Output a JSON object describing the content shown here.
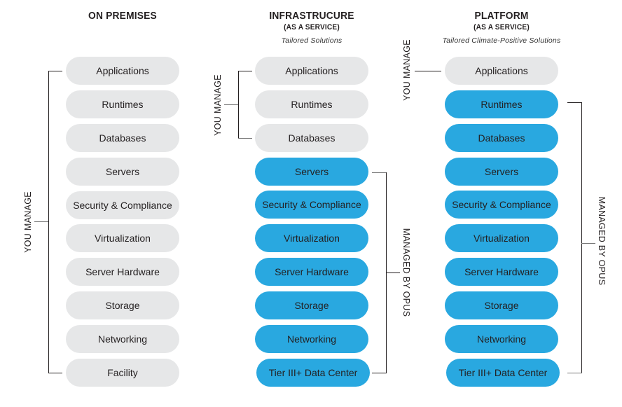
{
  "colors": {
    "customer_managed": "#E6E7E8",
    "opus_managed": "#29A8E0",
    "text": "#231F20"
  },
  "columns": [
    {
      "title": "ON PREMISES",
      "subtitle": "",
      "tagline": "",
      "items": [
        {
          "label": "Applications",
          "managed_by": "you"
        },
        {
          "label": "Runtimes",
          "managed_by": "you"
        },
        {
          "label": "Databases",
          "managed_by": "you"
        },
        {
          "label": "Servers",
          "managed_by": "you"
        },
        {
          "label": "Security & Compliance",
          "managed_by": "you"
        },
        {
          "label": "Virtualization",
          "managed_by": "you"
        },
        {
          "label": "Server Hardware",
          "managed_by": "you"
        },
        {
          "label": "Storage",
          "managed_by": "you"
        },
        {
          "label": "Networking",
          "managed_by": "you"
        },
        {
          "label": "Facility",
          "managed_by": "you"
        }
      ],
      "brackets": {
        "you_manage": "YOU MANAGE"
      }
    },
    {
      "title": "INFRASTRUCURE",
      "subtitle": "(AS A SERVICE)",
      "tagline": "Tailored Solutions",
      "items": [
        {
          "label": "Applications",
          "managed_by": "you"
        },
        {
          "label": "Runtimes",
          "managed_by": "you"
        },
        {
          "label": "Databases",
          "managed_by": "you"
        },
        {
          "label": "Servers",
          "managed_by": "opus"
        },
        {
          "label": "Security & Compliance",
          "managed_by": "opus"
        },
        {
          "label": "Virtualization",
          "managed_by": "opus"
        },
        {
          "label": "Server Hardware",
          "managed_by": "opus"
        },
        {
          "label": "Storage",
          "managed_by": "opus"
        },
        {
          "label": "Networking",
          "managed_by": "opus"
        },
        {
          "label": "Tier III+ Data Center",
          "managed_by": "opus"
        }
      ],
      "brackets": {
        "you_manage": "YOU MANAGE",
        "managed_by_opus": "MANAGED BY OPUS"
      }
    },
    {
      "title": "PLATFORM",
      "subtitle": "(AS A SERVICE)",
      "tagline": "Tailored Climate-Positive Solutions",
      "items": [
        {
          "label": "Applications",
          "managed_by": "you"
        },
        {
          "label": "Runtimes",
          "managed_by": "opus"
        },
        {
          "label": "Databases",
          "managed_by": "opus"
        },
        {
          "label": "Servers",
          "managed_by": "opus"
        },
        {
          "label": "Security & Compliance",
          "managed_by": "opus"
        },
        {
          "label": "Virtualization",
          "managed_by": "opus"
        },
        {
          "label": "Server Hardware",
          "managed_by": "opus"
        },
        {
          "label": "Storage",
          "managed_by": "opus"
        },
        {
          "label": "Networking",
          "managed_by": "opus"
        },
        {
          "label": "Tier III+ Data Center",
          "managed_by": "opus"
        }
      ],
      "brackets": {
        "you_manage": "YOU MANAGE",
        "managed_by_opus": "MANAGED BY OPUS"
      }
    }
  ]
}
